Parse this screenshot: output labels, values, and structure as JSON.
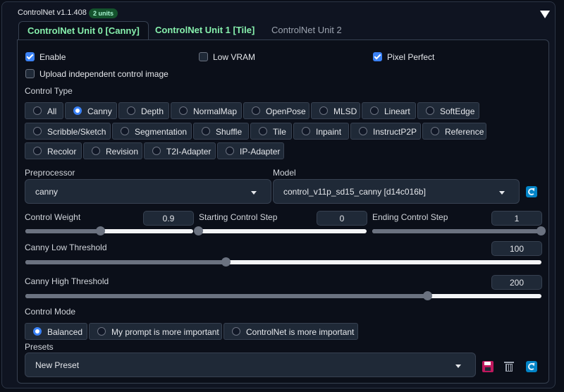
{
  "header": {
    "title": "ControlNet v1.1.408",
    "badge": "2 units",
    "collapse_icon": "triangle-down-icon"
  },
  "tabs": [
    {
      "label": "ControlNet Unit 0 [Canny]",
      "state": "active"
    },
    {
      "label": "ControlNet Unit 1 [Tile]",
      "state": "enabled"
    },
    {
      "label": "ControlNet Unit 2",
      "state": "inactive"
    }
  ],
  "options": {
    "enable": {
      "label": "Enable",
      "checked": true
    },
    "low_vram": {
      "label": "Low VRAM",
      "checked": false
    },
    "pixel_perfect": {
      "label": "Pixel Perfect",
      "checked": true
    },
    "upload_independent": {
      "label": "Upload independent control image",
      "checked": false
    }
  },
  "control_type": {
    "label": "Control Type",
    "selected": "Canny",
    "options": [
      "All",
      "Canny",
      "Depth",
      "NormalMap",
      "OpenPose",
      "MLSD",
      "Lineart",
      "SoftEdge",
      "Scribble/Sketch",
      "Segmentation",
      "Shuffle",
      "Tile",
      "Inpaint",
      "InstructP2P",
      "Reference",
      "Recolor",
      "Revision",
      "T2I-Adapter",
      "IP-Adapter"
    ]
  },
  "preprocessor": {
    "label": "Preprocessor",
    "value": "canny"
  },
  "model": {
    "label": "Model",
    "value": "control_v11p_sd15_canny [d14c016b]",
    "refresh_icon": "refresh-icon"
  },
  "sliders": {
    "control_weight": {
      "label": "Control Weight",
      "value": "0.9",
      "fraction": 0.45
    },
    "starting_step": {
      "label": "Starting Control Step",
      "value": "0",
      "fraction": 0.0
    },
    "ending_step": {
      "label": "Ending Control Step",
      "value": "1",
      "fraction": 1.0
    },
    "canny_low": {
      "label": "Canny Low Threshold",
      "value": "100",
      "fraction": 0.39
    },
    "canny_high": {
      "label": "Canny High Threshold",
      "value": "200",
      "fraction": 0.78
    }
  },
  "control_mode": {
    "label": "Control Mode",
    "selected": "Balanced",
    "options": [
      "Balanced",
      "My prompt is more important",
      "ControlNet is more important"
    ]
  },
  "presets": {
    "label": "Presets",
    "value": "New Preset",
    "icons": [
      "save-icon",
      "trash-icon",
      "refresh-icon"
    ]
  },
  "colors": {
    "accent": "#3b82f6",
    "tab_green": "#86efac",
    "background": "#0b0f19",
    "input_bg": "#1f2937"
  }
}
